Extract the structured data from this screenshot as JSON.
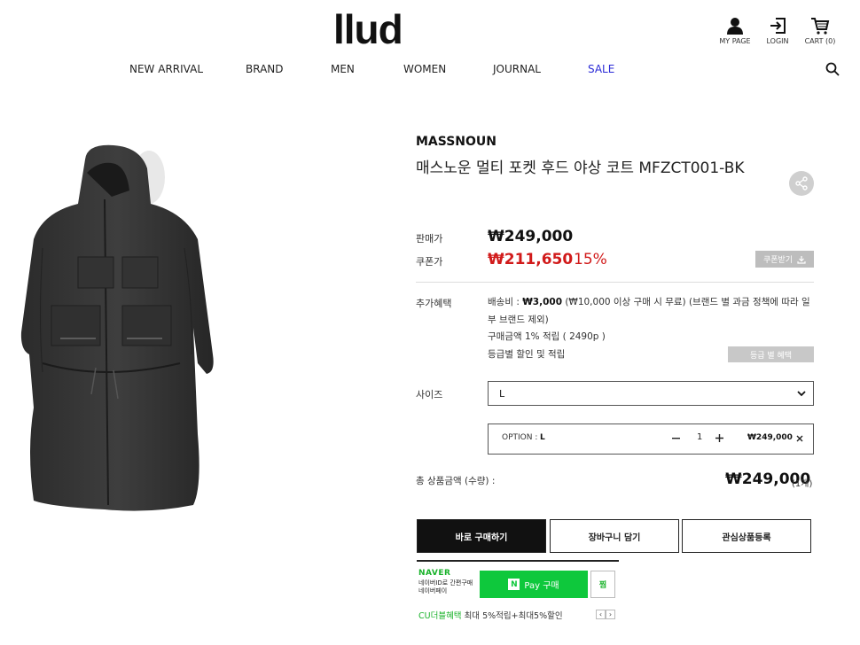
{
  "header": {
    "logo": "llud",
    "utils": [
      {
        "label": "MY PAGE",
        "icon": "person-icon"
      },
      {
        "label": "LOGIN",
        "icon": "login-icon"
      },
      {
        "label": "CART (0)",
        "icon": "cart-icon"
      }
    ],
    "nav": [
      "NEW ARRIVAL",
      "BRAND",
      "MEN",
      "WOMEN",
      "JOURNAL",
      "SALE"
    ],
    "sale_color": "#2a2ad6"
  },
  "product": {
    "brand": "MASSNOUN",
    "name": "매스노운 멀티 포켓 후드 야상 코트 MFZCT001-BK",
    "price_label": "판매가",
    "price": "₩249,000",
    "coupon_label": "쿠폰가",
    "coupon_price": "₩211,650",
    "discount": "15%",
    "coupon_button": "쿠폰받기",
    "benefit_label": "추가혜택",
    "benefit_ship_prefix": "배송비 : ",
    "benefit_ship_amount": "₩3,000",
    "benefit_ship_rest": " (₩10,000 이상 구매 시 무료) (브랜드 별 과금 정책에 따라 일부 브랜드 제외)",
    "benefit_points": "구매금액 1% 적립 ( 2490p )",
    "benefit_grade": "등급별 할인 및 적립",
    "grade_button": "등급 별 혜택",
    "size_label": "사이즈",
    "size_value": "L",
    "option_label": "OPTION : ",
    "option_value": "L",
    "quantity": "1",
    "option_price": "₩249,000",
    "total_label": "총 상품금액 (수량) :",
    "total_price": "₩249,000",
    "total_qty": "(1개)",
    "accent_red": "#d11a1a"
  },
  "actions": {
    "buy_now": "바로 구매하기",
    "add_cart": "장바구니 담기",
    "wishlist": "관심상품등록"
  },
  "npay": {
    "brand": "NAVER",
    "sub_line1": "네이버ID로 간편구매",
    "sub_line2": "네이버페이",
    "button": "Pay 구매",
    "n_mark": "N",
    "zzim": "찜",
    "event_highlight": "CU더블혜택",
    "event_text": " 최대 5%적립+최대5%할인",
    "green": "#0ec83c"
  }
}
